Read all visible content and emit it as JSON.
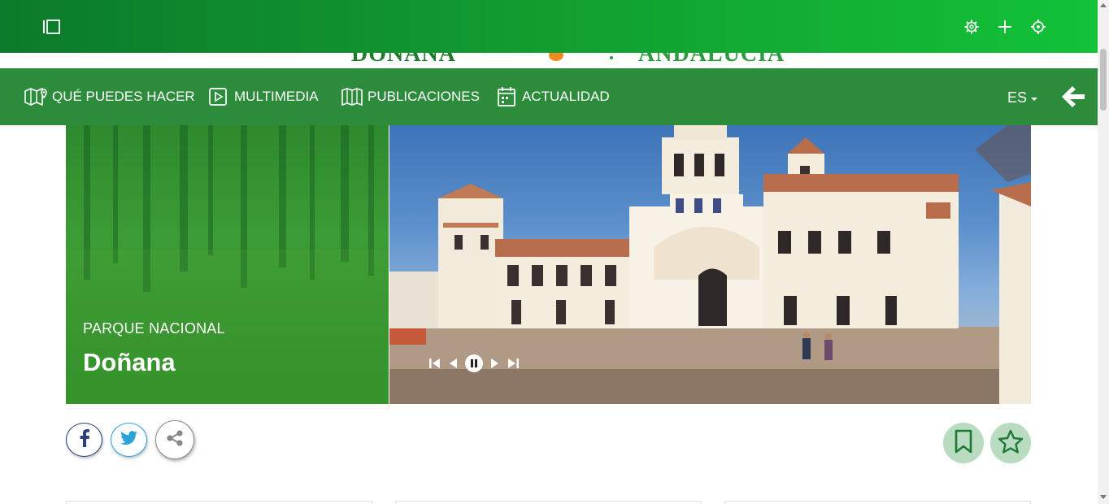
{
  "toolbar": {
    "sidebar_toggle": "sidebar-toggle-icon",
    "settings": "gear-icon",
    "add": "plus-icon",
    "locate": "crosshair-icon"
  },
  "logo": {
    "text_left": "DOÑANA",
    "text_right": "ANDALUCÍA"
  },
  "nav": {
    "items": [
      {
        "label": "QUÉ PUEDES HACER",
        "icon": "map-pin-icon"
      },
      {
        "label": "MULTIMEDIA",
        "icon": "play-icon"
      },
      {
        "label": "PUBLICACIONES",
        "icon": "book-icon"
      },
      {
        "label": "ACTUALIDAD",
        "icon": "calendar-icon"
      }
    ],
    "language": "ES",
    "back": "arrow-left-icon"
  },
  "hero": {
    "subtitle": "PARQUE NACIONAL",
    "title": "Doñana",
    "controls": [
      "first-icon",
      "previous-icon",
      "pause-icon",
      "next-icon",
      "last-icon"
    ]
  },
  "share": {
    "facebook": "facebook-icon",
    "twitter": "twitter-icon",
    "share": "share-icon"
  },
  "actions": {
    "bookmark": "bookmark-icon",
    "favorite": "star-icon"
  },
  "colors": {
    "toolbar_start": "#0b7a2a",
    "toolbar_end": "#12c238",
    "nav_bg": "#2d8c3c",
    "action_bg": "#b9dcc0",
    "action_icon": "#1e7a36",
    "facebook": "#2b3f7a",
    "twitter": "#2aa3d9"
  }
}
